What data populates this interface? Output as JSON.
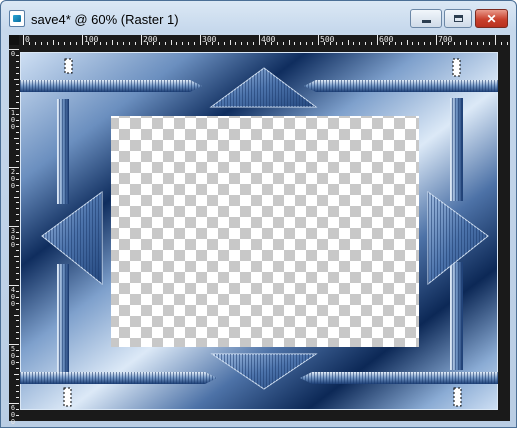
{
  "window": {
    "title": "save4* @  60% (Raster 1)",
    "icon": "psp-image-icon",
    "controls": {
      "minimize": "minimize-icon",
      "maximize": "maximize-icon",
      "close": "close-icon",
      "close_glyph": "✕"
    }
  },
  "ruler": {
    "horizontal_labels": [
      "0",
      "100",
      "200",
      "300",
      "400",
      "500",
      "600",
      "700"
    ],
    "vertical_labels": [
      "0",
      "100",
      "200",
      "300",
      "400",
      "500",
      "600"
    ]
  },
  "colors": {
    "frame_dark": "#0e2a59",
    "frame_light": "#c5d7ee",
    "ruler_bg": "#1a1a1a",
    "close_red": "#c9412d"
  }
}
